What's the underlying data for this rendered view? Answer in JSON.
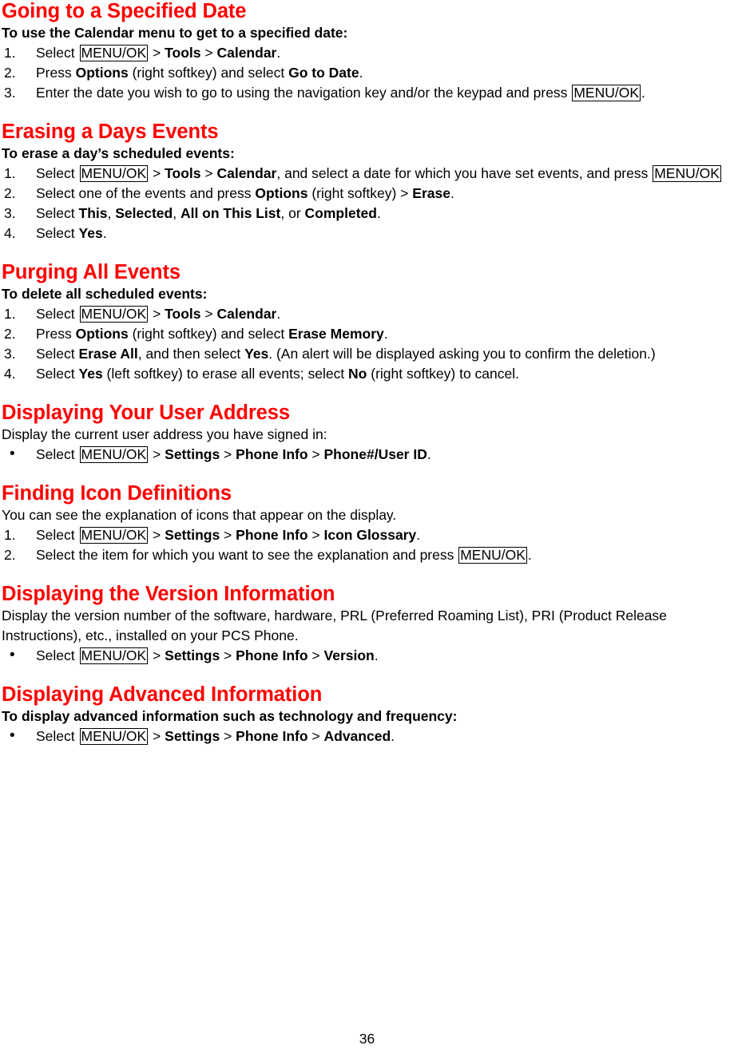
{
  "document": {
    "page_number": "36",
    "accent_color": "#ff0000",
    "text_color": "#000000",
    "background_color": "#ffffff"
  },
  "keys": {
    "menu_ok": "MENU/OK"
  },
  "sections": [
    {
      "heading": "Going to a Specified Date",
      "lead": "To use the Calendar menu to get to a specified date:",
      "list_type": "ordered",
      "steps": [
        {
          "marker": "1.",
          "parts": [
            {
              "t": "Select ",
              "s": "plain"
            },
            {
              "t": "MENU/OK",
              "s": "key"
            },
            {
              "t": " > ",
              "s": "plain"
            },
            {
              "t": "Tools",
              "s": "bold"
            },
            {
              "t": " > ",
              "s": "plain"
            },
            {
              "t": "Calendar",
              "s": "bold"
            },
            {
              "t": ".",
              "s": "plain"
            }
          ]
        },
        {
          "marker": "2.",
          "parts": [
            {
              "t": "Press ",
              "s": "plain"
            },
            {
              "t": "Options",
              "s": "bold"
            },
            {
              "t": " (right softkey) and select ",
              "s": "plain"
            },
            {
              "t": "Go to Date",
              "s": "bold"
            },
            {
              "t": ".",
              "s": "plain"
            }
          ]
        },
        {
          "marker": "3.",
          "parts": [
            {
              "t": "Enter the date you wish to go to using the navigation key and/or the keypad and press ",
              "s": "plain"
            },
            {
              "t": "MENU/OK",
              "s": "key"
            },
            {
              "t": ".",
              "s": "plain"
            }
          ]
        }
      ]
    },
    {
      "heading": "Erasing a Days Events",
      "lead": "To erase a day’s scheduled events:",
      "list_type": "ordered",
      "steps": [
        {
          "marker": "1.",
          "justify": true,
          "parts": [
            {
              "t": "Select ",
              "s": "plain"
            },
            {
              "t": "MENU/OK",
              "s": "key"
            },
            {
              "t": " > ",
              "s": "plain"
            },
            {
              "t": "Tools",
              "s": "bold"
            },
            {
              "t": " > ",
              "s": "plain"
            },
            {
              "t": "Calendar",
              "s": "bold"
            },
            {
              "t": ", and select a date for which you have set events, and press ",
              "s": "plain"
            },
            {
              "t": "MENU/OK",
              "s": "key"
            }
          ]
        },
        {
          "marker": "2.",
          "parts": [
            {
              "t": "Select one of the events and press ",
              "s": "plain"
            },
            {
              "t": "Options",
              "s": "bold"
            },
            {
              "t": " (right softkey) > ",
              "s": "plain"
            },
            {
              "t": "Erase",
              "s": "bold"
            },
            {
              "t": ".",
              "s": "plain"
            }
          ]
        },
        {
          "marker": "3.",
          "parts": [
            {
              "t": "Select ",
              "s": "plain"
            },
            {
              "t": "This",
              "s": "bold"
            },
            {
              "t": ", ",
              "s": "plain"
            },
            {
              "t": "Selected",
              "s": "bold"
            },
            {
              "t": ", ",
              "s": "plain"
            },
            {
              "t": "All on This List",
              "s": "bold"
            },
            {
              "t": ", or ",
              "s": "plain"
            },
            {
              "t": "Completed",
              "s": "bold"
            },
            {
              "t": ".",
              "s": "plain"
            }
          ]
        },
        {
          "marker": "4.",
          "parts": [
            {
              "t": "Select ",
              "s": "plain"
            },
            {
              "t": "Yes",
              "s": "bold"
            },
            {
              "t": ".",
              "s": "plain"
            }
          ]
        }
      ]
    },
    {
      "heading": "Purging All Events",
      "lead": "To delete all scheduled events:",
      "list_type": "ordered",
      "steps": [
        {
          "marker": "1.",
          "parts": [
            {
              "t": "Select ",
              "s": "plain"
            },
            {
              "t": "MENU/OK",
              "s": "key"
            },
            {
              "t": " > ",
              "s": "plain"
            },
            {
              "t": "Tools",
              "s": "bold"
            },
            {
              "t": " > ",
              "s": "plain"
            },
            {
              "t": "Calendar",
              "s": "bold"
            },
            {
              "t": ".",
              "s": "plain"
            }
          ]
        },
        {
          "marker": "2.",
          "parts": [
            {
              "t": "Press ",
              "s": "plain"
            },
            {
              "t": "Options",
              "s": "bold"
            },
            {
              "t": " (right softkey) and select ",
              "s": "plain"
            },
            {
              "t": "Erase Memory",
              "s": "bold"
            },
            {
              "t": ".",
              "s": "plain"
            }
          ]
        },
        {
          "marker": "3.",
          "parts": [
            {
              "t": "Select ",
              "s": "plain"
            },
            {
              "t": "Erase All",
              "s": "bold"
            },
            {
              "t": ", and then select ",
              "s": "plain"
            },
            {
              "t": "Yes",
              "s": "bold"
            },
            {
              "t": ". (An alert will be displayed asking you to confirm the deletion.)",
              "s": "plain"
            }
          ]
        },
        {
          "marker": "4.",
          "parts": [
            {
              "t": "Select ",
              "s": "plain"
            },
            {
              "t": "Yes",
              "s": "bold"
            },
            {
              "t": " (left softkey) to erase all events; select ",
              "s": "plain"
            },
            {
              "t": "No",
              "s": "bold"
            },
            {
              "t": " (right softkey) to cancel.",
              "s": "plain"
            }
          ]
        }
      ]
    },
    {
      "heading": "Displaying Your User Address",
      "lead": "Display the current user address you have signed in:",
      "lead_bold": false,
      "list_type": "bulleted",
      "steps": [
        {
          "marker": "•",
          "parts": [
            {
              "t": "Select ",
              "s": "plain"
            },
            {
              "t": "MENU/OK",
              "s": "key"
            },
            {
              "t": " > ",
              "s": "plain"
            },
            {
              "t": "Settings",
              "s": "bold"
            },
            {
              "t": " > ",
              "s": "plain"
            },
            {
              "t": "Phone Info",
              "s": "bold"
            },
            {
              "t": " > ",
              "s": "plain"
            },
            {
              "t": "Phone#/User ID",
              "s": "bold"
            },
            {
              "t": ".",
              "s": "plain"
            }
          ]
        }
      ]
    },
    {
      "heading": "Finding Icon Definitions",
      "lead": "You can see the explanation of icons that appear on the display.",
      "lead_bold": false,
      "list_type": "ordered",
      "steps": [
        {
          "marker": "1.",
          "parts": [
            {
              "t": "Select ",
              "s": "plain"
            },
            {
              "t": "MENU/OK",
              "s": "key"
            },
            {
              "t": " > ",
              "s": "plain"
            },
            {
              "t": "Settings",
              "s": "bold"
            },
            {
              "t": " > ",
              "s": "plain"
            },
            {
              "t": "Phone Info",
              "s": "bold"
            },
            {
              "t": " > ",
              "s": "plain"
            },
            {
              "t": "Icon Glossary",
              "s": "bold"
            },
            {
              "t": ".",
              "s": "plain"
            }
          ]
        },
        {
          "marker": "2.",
          "parts": [
            {
              "t": "Select the item for which you want to see the explanation and press ",
              "s": "plain"
            },
            {
              "t": "MENU/OK",
              "s": "key"
            },
            {
              "t": ".",
              "s": "plain"
            }
          ]
        }
      ]
    },
    {
      "heading": "Displaying the Version Information",
      "lead": "Display the version number of the software, hardware, PRL (Preferred Roaming List), PRI (Product Release Instructions), etc., installed on your PCS Phone.",
      "lead_bold": false,
      "lead_wrap": true,
      "list_type": "bulleted",
      "steps": [
        {
          "marker": "•",
          "parts": [
            {
              "t": "Select ",
              "s": "plain"
            },
            {
              "t": "MENU/OK",
              "s": "key"
            },
            {
              "t": " > ",
              "s": "plain"
            },
            {
              "t": "Settings",
              "s": "bold"
            },
            {
              "t": " > ",
              "s": "plain"
            },
            {
              "t": "Phone Info",
              "s": "bold"
            },
            {
              "t": " > ",
              "s": "plain"
            },
            {
              "t": "Version",
              "s": "bold"
            },
            {
              "t": ".",
              "s": "plain"
            }
          ]
        }
      ]
    },
    {
      "heading": "Displaying Advanced Information",
      "lead": "To display advanced information such as technology and frequency:",
      "list_type": "bulleted",
      "steps": [
        {
          "marker": "•",
          "parts": [
            {
              "t": "Select ",
              "s": "plain"
            },
            {
              "t": "MENU/OK",
              "s": "key"
            },
            {
              "t": " > ",
              "s": "plain"
            },
            {
              "t": "Settings",
              "s": "bold"
            },
            {
              "t": " > ",
              "s": "plain"
            },
            {
              "t": "Phone Info",
              "s": "bold"
            },
            {
              "t": " > ",
              "s": "plain"
            },
            {
              "t": "Advanced",
              "s": "bold"
            },
            {
              "t": ".",
              "s": "plain"
            }
          ]
        }
      ]
    }
  ]
}
